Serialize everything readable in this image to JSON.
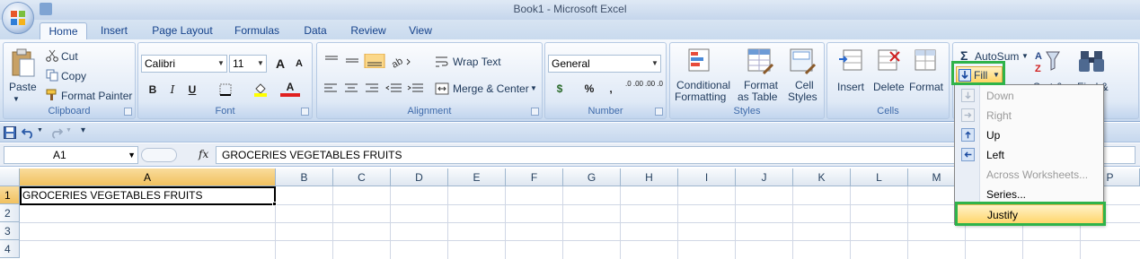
{
  "window": {
    "title": "Book1 - Microsoft Excel"
  },
  "tabs": [
    "Home",
    "Insert",
    "Page Layout",
    "Formulas",
    "Data",
    "Review",
    "View"
  ],
  "active_tab": "Home",
  "clipboard": {
    "paste": "Paste",
    "cut": "Cut",
    "copy": "Copy",
    "format_painter": "Format Painter",
    "label": "Clipboard"
  },
  "font": {
    "name": "Calibri",
    "size": "11",
    "bold": "B",
    "italic": "I",
    "underline": "U",
    "grow": "A",
    "shrink": "A",
    "color_letter": "A",
    "label": "Font"
  },
  "alignment": {
    "wrap_text": "Wrap Text",
    "merge_center": "Merge & Center",
    "label": "Alignment"
  },
  "number": {
    "format": "General",
    "currency": "$",
    "percent": "%",
    "comma": ",",
    "inc_decimal": ".0 .00",
    "dec_decimal": ".00 .0",
    "label": "Number"
  },
  "styles": {
    "conditional_1": "Conditional",
    "conditional_2": "Formatting",
    "format_table_1": "Format",
    "format_table_2": "as Table",
    "cell_styles_1": "Cell",
    "cell_styles_2": "Styles",
    "label": "Styles"
  },
  "cells": {
    "insert": "Insert",
    "delete": "Delete",
    "format": "Format",
    "label": "Cells"
  },
  "editing": {
    "autosum": "AutoSum",
    "fill": "Fill",
    "sort_partial": "Sort &",
    "find_partial": "Find &"
  },
  "fill_menu": [
    {
      "label": "Down",
      "enabled": false,
      "icon": "fill-down-icon"
    },
    {
      "label": "Right",
      "enabled": false,
      "icon": "fill-right-icon"
    },
    {
      "label": "Up",
      "enabled": true,
      "icon": "fill-up-icon"
    },
    {
      "label": "Left",
      "enabled": true,
      "icon": "fill-left-icon"
    },
    {
      "label": "Across Worksheets...",
      "enabled": false,
      "icon": ""
    },
    {
      "label": "Series...",
      "enabled": true,
      "icon": ""
    },
    {
      "label": "Justify",
      "enabled": true,
      "icon": "",
      "highlighted": true
    }
  ],
  "formula_bar": {
    "name_box": "A1",
    "fx": "fx",
    "content": "GROCERIES VEGETABLES FRUITS"
  },
  "columns": [
    "A",
    "B",
    "C",
    "D",
    "E",
    "F",
    "G",
    "H",
    "I",
    "J",
    "K",
    "L",
    "M",
    "P"
  ],
  "rows": [
    "1",
    "2",
    "3",
    "4"
  ],
  "cells_data": {
    "A1": "GROCERIES VEGETABLES FRUITS"
  },
  "colors": {
    "highlight_box": "#2fb34a",
    "menu_highlight": "#ffd66b",
    "selected_header": "#f1c15f"
  }
}
